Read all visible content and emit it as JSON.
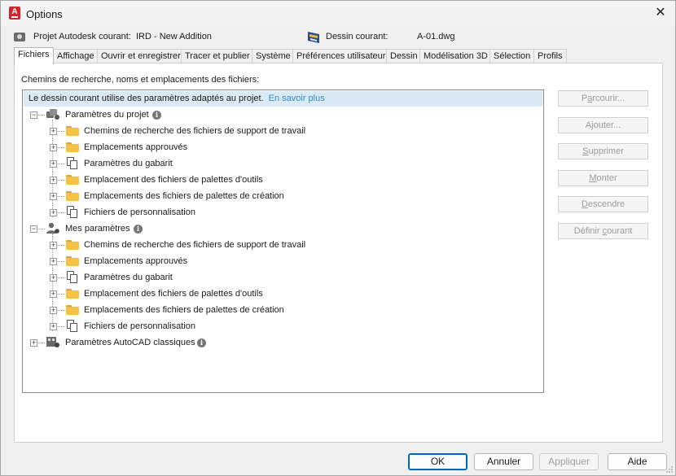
{
  "window": {
    "title": "Options",
    "close_glyph": "✕",
    "app_icon_letter": "A"
  },
  "info": {
    "project_label": "Projet Autodesk courant:",
    "project_value": "IRD - New Addition",
    "drawing_label": "Dessin courant:",
    "drawing_value": "A-01.dwg"
  },
  "tabs": [
    {
      "label": "Fichiers",
      "active": true
    },
    {
      "label": "Affichage"
    },
    {
      "label": "Ouvrir et enregistrer"
    },
    {
      "label": "Tracer et publier"
    },
    {
      "label": "Système"
    },
    {
      "label": "Préférences utilisateur"
    },
    {
      "label": "Dessin"
    },
    {
      "label": "Modélisation 3D"
    },
    {
      "label": "Sélection"
    },
    {
      "label": "Profils"
    }
  ],
  "panel": {
    "heading": "Chemins de recherche, noms et emplacements des fichiers:",
    "banner_text": "Le dessin courant utilise des paramètres adaptés au projet.",
    "banner_link": "En savoir plus"
  },
  "tree": {
    "groups": [
      {
        "label": "Paramètres du projet",
        "icon": "project-settings-icon",
        "children": [
          {
            "label": "Chemins de recherche des fichiers de support de travail",
            "icon": "folder-icon"
          },
          {
            "label": "Emplacements approuvés",
            "icon": "folder-icon"
          },
          {
            "label": "Paramètres du gabarit",
            "icon": "document-stack-icon"
          },
          {
            "label": "Emplacement des fichiers de palettes d'outils",
            "icon": "folder-icon"
          },
          {
            "label": "Emplacements des fichiers de palettes de création",
            "icon": "folder-icon"
          },
          {
            "label": "Fichiers de personnalisation",
            "icon": "document-stack-icon"
          }
        ]
      },
      {
        "label": "Mes paramètres",
        "icon": "user-settings-icon",
        "children": [
          {
            "label": "Chemins de recherche des fichiers de support de travail",
            "icon": "folder-icon"
          },
          {
            "label": "Emplacements approuvés",
            "icon": "folder-icon"
          },
          {
            "label": "Paramètres du gabarit",
            "icon": "document-stack-icon"
          },
          {
            "label": "Emplacement des fichiers de palettes d'outils",
            "icon": "folder-icon"
          },
          {
            "label": "Emplacements des fichiers de palettes de création",
            "icon": "folder-icon"
          },
          {
            "label": "Fichiers de personnalisation",
            "icon": "document-stack-icon"
          }
        ]
      },
      {
        "label": "Paramètres AutoCAD classiques",
        "icon": "classic-settings-icon",
        "children": []
      }
    ]
  },
  "side_buttons": [
    {
      "label": "Parcourir...",
      "mnemonic_index": 1,
      "enabled": false
    },
    {
      "label": "Ajouter...",
      "mnemonic_index": 1,
      "enabled": false
    },
    {
      "label": "Supprimer",
      "mnemonic_index": 0,
      "enabled": false
    },
    {
      "label": "Monter",
      "mnemonic_index": 0,
      "enabled": false
    },
    {
      "label": "Descendre",
      "mnemonic_index": 0,
      "enabled": false
    },
    {
      "label": "Définir courant",
      "mnemonic_index": 8,
      "enabled": false
    }
  ],
  "footer": {
    "ok": "OK",
    "cancel": "Annuler",
    "apply": "Appliquer",
    "help": "Aide"
  },
  "colors": {
    "accent": "#0067c0",
    "link": "#2e8ccb",
    "banner_bg": "#d9eaf4",
    "folder": "#f6c243",
    "app_icon": "#d0252c"
  }
}
